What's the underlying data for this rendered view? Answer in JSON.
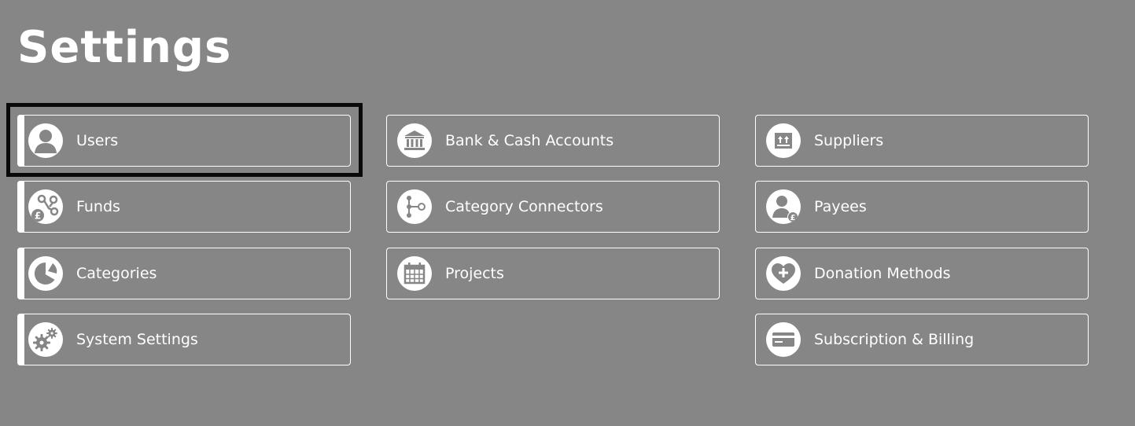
{
  "page": {
    "title": "Settings",
    "background_color": "#868686",
    "focus_ring_color": "#0a0a0a",
    "focused_item": "users"
  },
  "columns": [
    {
      "items": [
        {
          "id": "users",
          "label": "Users",
          "icon": "user-icon"
        },
        {
          "id": "funds",
          "label": "Funds",
          "icon": "funds-network-pound-icon"
        },
        {
          "id": "categories",
          "label": "Categories",
          "icon": "pie-chart-icon"
        },
        {
          "id": "system-settings",
          "label": "System Settings",
          "icon": "gears-icon"
        }
      ]
    },
    {
      "items": [
        {
          "id": "bank-cash-accounts",
          "label": "Bank & Cash Accounts",
          "icon": "bank-icon"
        },
        {
          "id": "category-connectors",
          "label": "Category Connectors",
          "icon": "connector-icon"
        },
        {
          "id": "projects",
          "label": "Projects",
          "icon": "calendar-icon"
        }
      ]
    },
    {
      "items": [
        {
          "id": "suppliers",
          "label": "Suppliers",
          "icon": "box-icon"
        },
        {
          "id": "payees",
          "label": "Payees",
          "icon": "user-pound-icon"
        },
        {
          "id": "donation-methods",
          "label": "Donation Methods",
          "icon": "heart-plus-icon"
        },
        {
          "id": "subscription-billing",
          "label": "Subscription & Billing",
          "icon": "credit-card-icon"
        }
      ]
    }
  ]
}
